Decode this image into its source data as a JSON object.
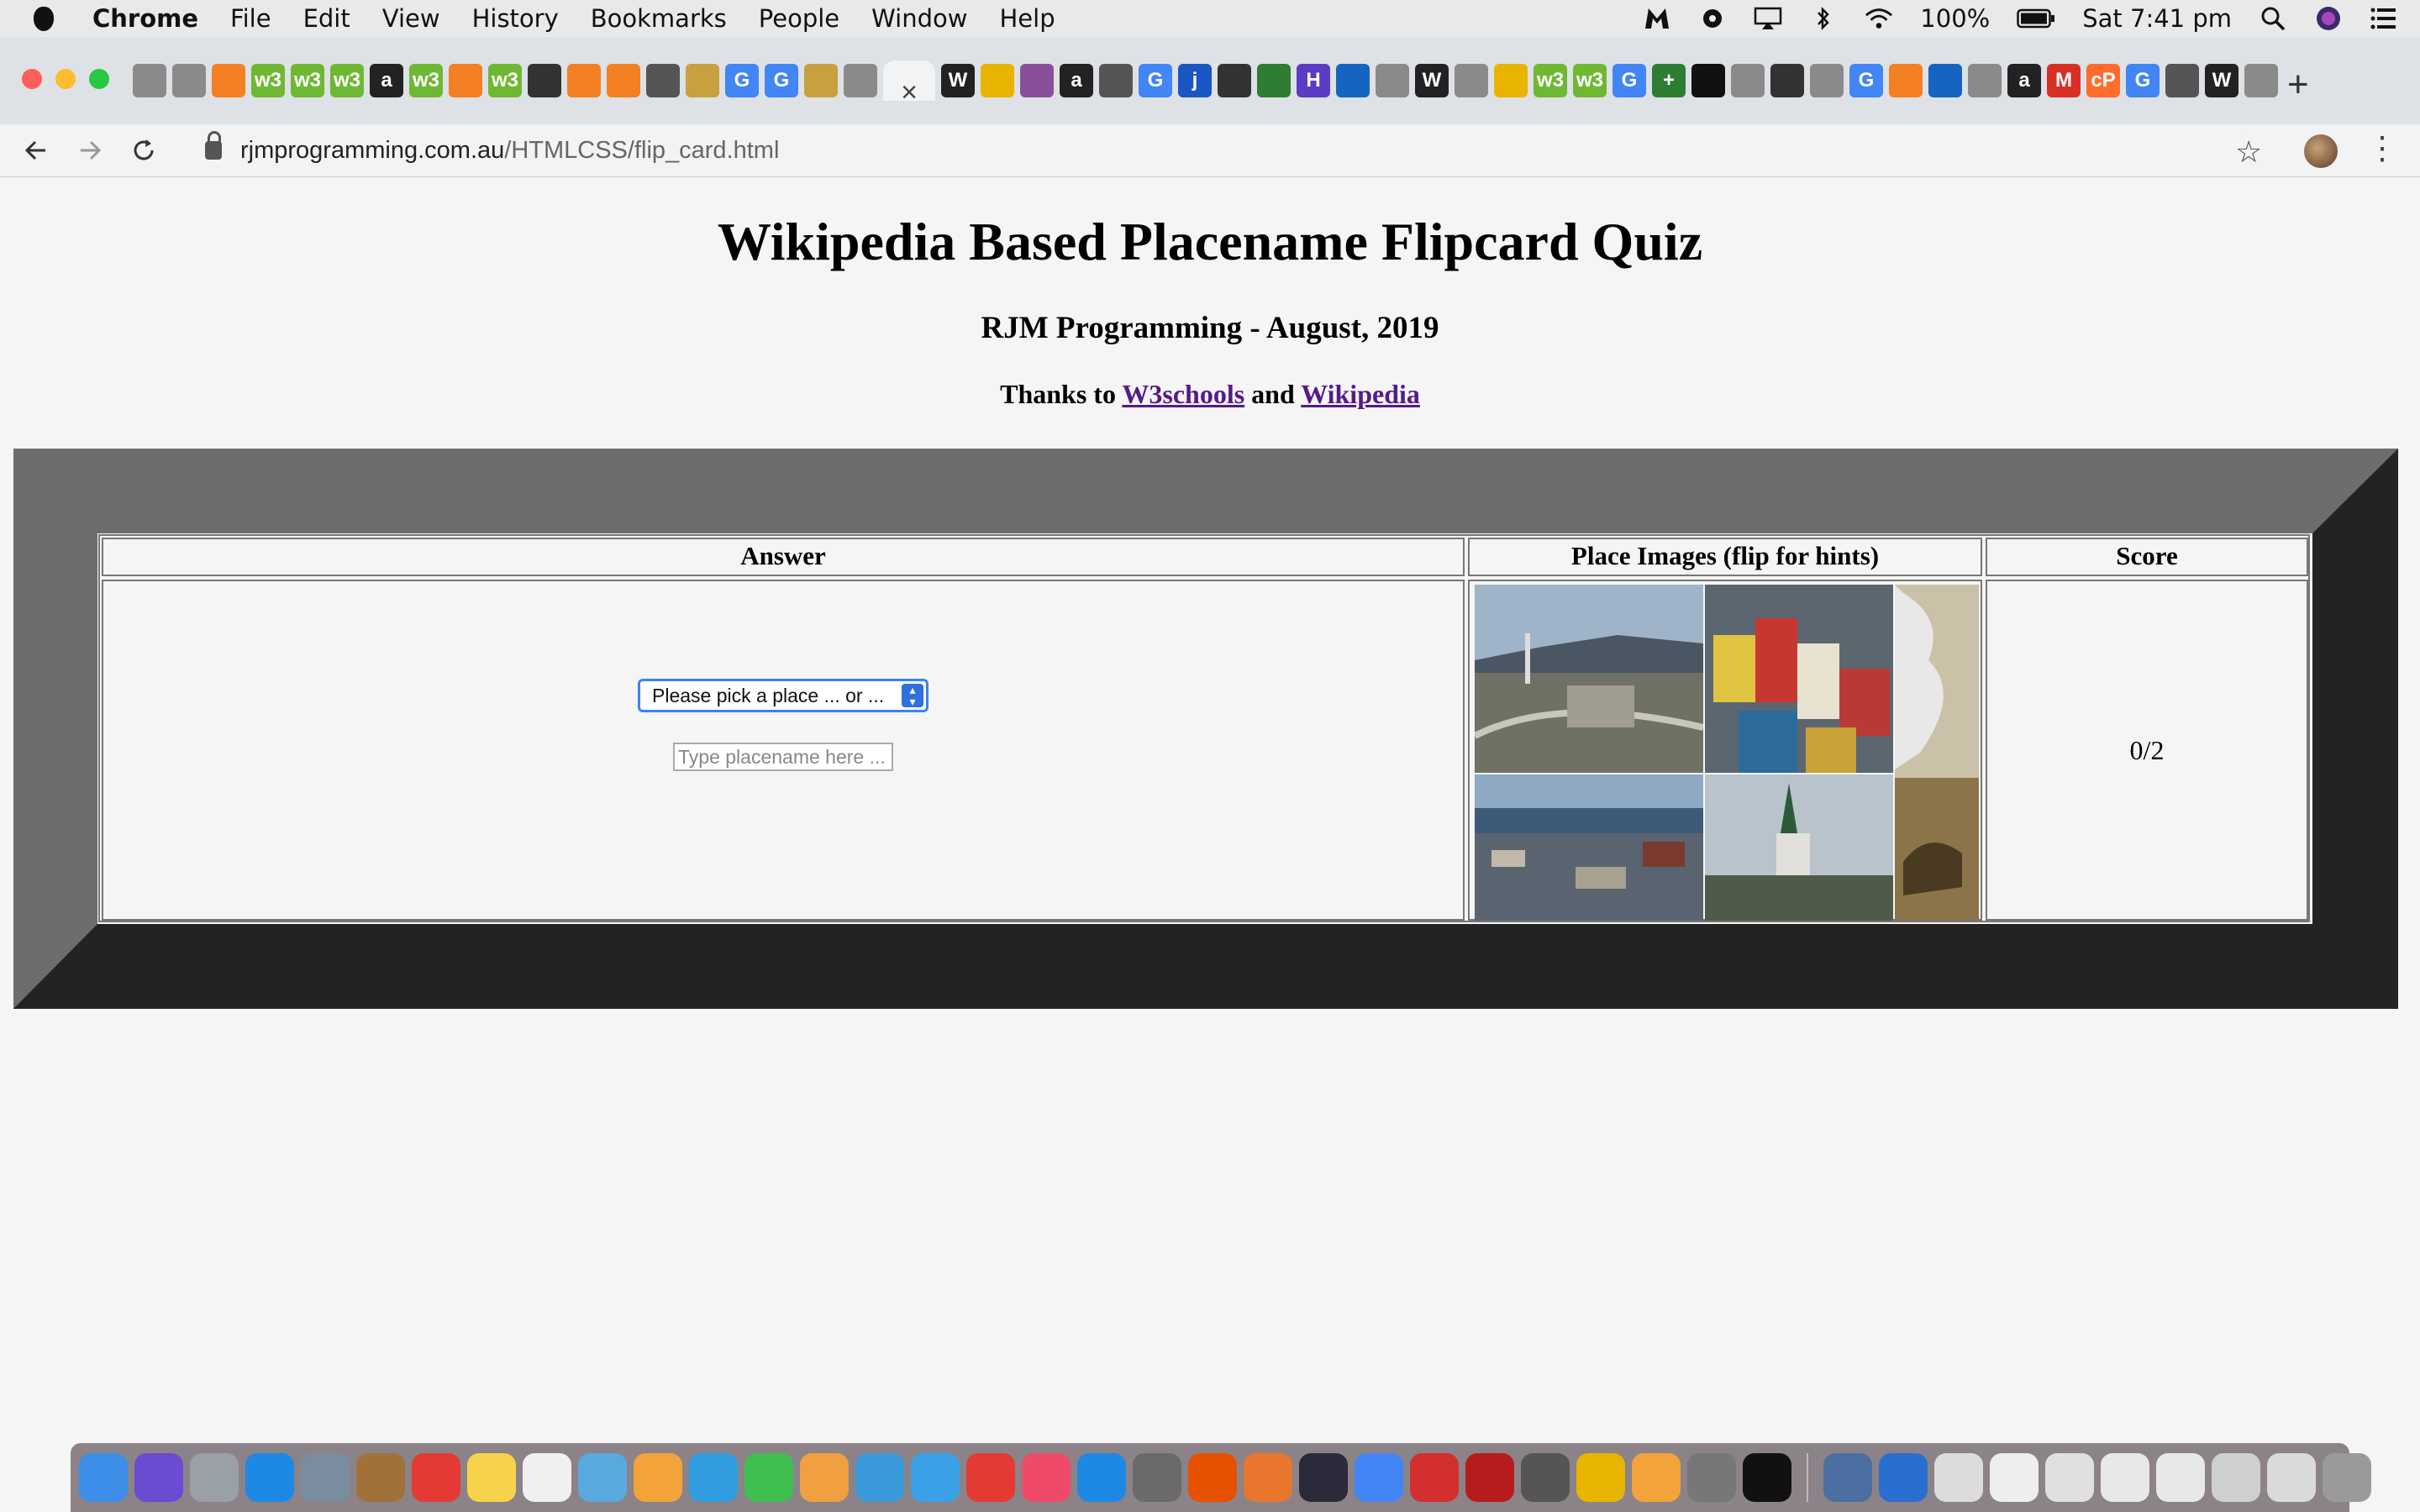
{
  "menubar": {
    "app": "Chrome",
    "items": [
      "File",
      "Edit",
      "View",
      "History",
      "Bookmarks",
      "People",
      "Window",
      "Help"
    ],
    "battery": "100%",
    "clock": "Sat 7:41 pm"
  },
  "browser": {
    "tab_favicons": [
      {
        "glyph": "",
        "color": "#8a8a8a"
      },
      {
        "glyph": "",
        "color": "#8a8a8a"
      },
      {
        "glyph": "",
        "color": "#f48024"
      },
      {
        "glyph": "w3",
        "color": "#6fb833"
      },
      {
        "glyph": "w3",
        "color": "#6fb833"
      },
      {
        "glyph": "w3",
        "color": "#6fb833"
      },
      {
        "glyph": "a",
        "color": "#222222"
      },
      {
        "glyph": "w3",
        "color": "#6fb833"
      },
      {
        "glyph": "",
        "color": "#f48024"
      },
      {
        "glyph": "w3",
        "color": "#6fb833"
      },
      {
        "glyph": "",
        "color": "#333333"
      },
      {
        "glyph": "",
        "color": "#f48024"
      },
      {
        "glyph": "",
        "color": "#f48024"
      },
      {
        "glyph": "",
        "color": "#555555"
      },
      {
        "glyph": "",
        "color": "#c8a040"
      },
      {
        "glyph": "G",
        "color": "#4285f4"
      },
      {
        "glyph": "G",
        "color": "#4285f4"
      },
      {
        "glyph": "",
        "color": "#c8a040"
      },
      {
        "glyph": "",
        "color": "#8a8a8a"
      }
    ],
    "tab_favicons_after": [
      {
        "glyph": "W",
        "color": "#222222"
      },
      {
        "glyph": "",
        "color": "#e8b400"
      },
      {
        "glyph": "",
        "color": "#8a4f9b"
      },
      {
        "glyph": "a",
        "color": "#222222"
      },
      {
        "glyph": "",
        "color": "#555555"
      },
      {
        "glyph": "G",
        "color": "#4285f4"
      },
      {
        "glyph": "j",
        "color": "#1a56c4"
      },
      {
        "glyph": "",
        "color": "#333333"
      },
      {
        "glyph": "",
        "color": "#2e7d32"
      },
      {
        "glyph": "H",
        "color": "#5b3cc4"
      },
      {
        "glyph": "",
        "color": "#1565c0"
      },
      {
        "glyph": "",
        "color": "#8a8a8a"
      },
      {
        "glyph": "W",
        "color": "#222222"
      },
      {
        "glyph": "",
        "color": "#8a8a8a"
      },
      {
        "glyph": "",
        "color": "#e8b400"
      },
      {
        "glyph": "w3",
        "color": "#6fb833"
      },
      {
        "glyph": "w3",
        "color": "#6fb833"
      },
      {
        "glyph": "G",
        "color": "#4285f4"
      },
      {
        "glyph": "+",
        "color": "#2e7d32"
      },
      {
        "glyph": "",
        "color": "#111111"
      },
      {
        "glyph": "",
        "color": "#8a8a8a"
      },
      {
        "glyph": "",
        "color": "#333333"
      },
      {
        "glyph": "",
        "color": "#8a8a8a"
      },
      {
        "glyph": "G",
        "color": "#4285f4"
      },
      {
        "glyph": "",
        "color": "#f48024"
      },
      {
        "glyph": "",
        "color": "#1565c0"
      },
      {
        "glyph": "",
        "color": "#8a8a8a"
      },
      {
        "glyph": "a",
        "color": "#222222"
      },
      {
        "glyph": "M",
        "color": "#d93025"
      },
      {
        "glyph": "cP",
        "color": "#ff6c2c"
      },
      {
        "glyph": "G",
        "color": "#4285f4"
      },
      {
        "glyph": "",
        "color": "#555555"
      },
      {
        "glyph": "W",
        "color": "#222222"
      },
      {
        "glyph": "",
        "color": "#8a8a8a"
      }
    ],
    "active_tab_close": "×",
    "url_host": "rjmprogramming.com.au",
    "url_path": "/HTMLCSS/flip_card.html"
  },
  "page": {
    "title": "Wikipedia Based Placename Flipcard Quiz",
    "subtitle": "RJM Programming - August, 2019",
    "thanks_prefix": "Thanks to",
    "thanks_link1": "W3schools",
    "thanks_and": "and",
    "thanks_link2": "Wikipedia",
    "table": {
      "col_answer": "Answer",
      "col_images": "Place Images (flip for hints)",
      "col_score": "Score",
      "select_value": "Please pick a place ... or ...",
      "input_placeholder": "Type placename here ...",
      "score": "0/2"
    }
  },
  "dock": {
    "icons": [
      "#3d8ee8",
      "#6a4bd1",
      "#9aa0a8",
      "#1e88e5",
      "#7a8da0",
      "#a0723a",
      "#e53935",
      "#f6d34a",
      "#f0f0f0",
      "#5aa8e0",
      "#f2a33a",
      "#2f9de0",
      "#3fbf4f",
      "#f0a040",
      "#3a9ad9",
      "#3aa0e8",
      "#e53935",
      "#f04a6a",
      "#1e88e5",
      "#6a6a6a",
      "#e65100",
      "#e8762c",
      "#2a2a3a",
      "#4285f4",
      "#d32f2f",
      "#b71c1c",
      "#555555",
      "#e8b400",
      "#f2a33a",
      "#777777",
      "#111111"
    ],
    "icons_right": [
      "#4a6fa0",
      "#2a6fd0",
      "#dcdcdc",
      "#eeeeee",
      "#e0e0e0",
      "#e8e8e8",
      "#e8e8e8",
      "#cfcfcf",
      "#dadada",
      "#9a9a9a"
    ]
  }
}
